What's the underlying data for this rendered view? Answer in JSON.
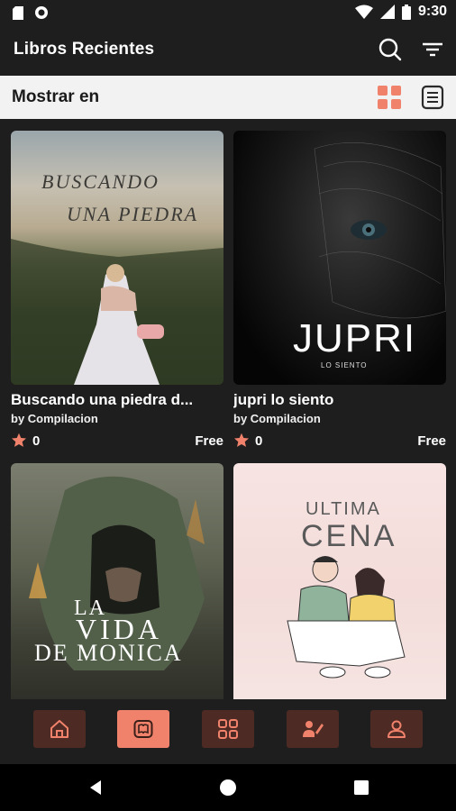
{
  "status_bar": {
    "time": "9:30"
  },
  "app_bar": {
    "title": "Libros Recientes"
  },
  "view_bar": {
    "label": "Mostrar en"
  },
  "books": [
    {
      "title": "Buscando una piedra d...",
      "author": "by Compilacion",
      "rating": "0",
      "price": "Free",
      "cover_lines": [
        "BUSCANDO",
        "UNA PIEDRA"
      ]
    },
    {
      "title": "jupri lo siento",
      "author": "by Compilacion",
      "rating": "0",
      "price": "Free",
      "cover_lines": [
        "JUPRI",
        "LO SIENTO"
      ]
    },
    {
      "title": "",
      "author": "",
      "rating": "",
      "price": "",
      "cover_lines": [
        "LA",
        "VIDA",
        "DE MONICA"
      ]
    },
    {
      "title": "",
      "author": "",
      "rating": "",
      "price": "",
      "cover_lines": [
        "ULTIMA",
        "CENA"
      ]
    }
  ],
  "colors": {
    "accent": "#f0826b",
    "nav_inactive": "#4d2a23",
    "background": "#1e1e1e",
    "star": "#f0826b"
  },
  "bottom_nav": [
    {
      "icon": "home-icon",
      "active": false
    },
    {
      "icon": "book-icon",
      "active": true
    },
    {
      "icon": "grid-icon",
      "active": false
    },
    {
      "icon": "writer-icon",
      "active": false
    },
    {
      "icon": "user-icon",
      "active": false
    }
  ]
}
